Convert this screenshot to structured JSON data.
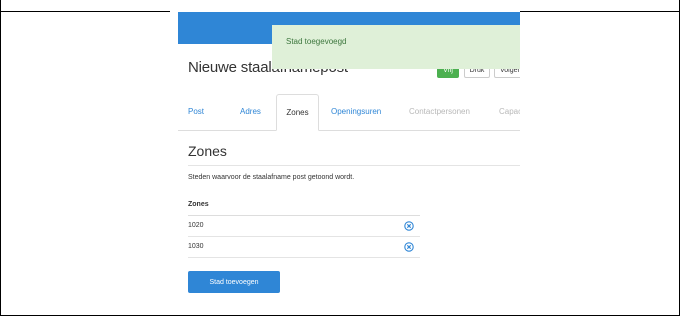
{
  "toast": {
    "message": "Stad toegevoegd"
  },
  "header": {
    "title": "Nieuwe staalafnamepost",
    "buttons": {
      "save": "Vrij",
      "print": "Druk",
      "next": "Volgende"
    }
  },
  "tabs": [
    {
      "label": "Post",
      "state": "link"
    },
    {
      "label": "Adres",
      "state": "link"
    },
    {
      "label": "Zones",
      "state": "active"
    },
    {
      "label": "Openingsuren",
      "state": "link"
    },
    {
      "label": "Contactpersonen",
      "state": "disabled"
    },
    {
      "label": "Capaciteit",
      "state": "disabled"
    }
  ],
  "zones": {
    "section_title": "Zones",
    "description": "Steden waarvoor de staalafname post getoond wordt.",
    "column_header": "Zones",
    "rows": [
      {
        "value": "1020"
      },
      {
        "value": "1030"
      }
    ],
    "remove_icon": "remove-circle-icon",
    "add_button": "Stad toevoegen"
  },
  "colors": {
    "navbar": "#2f86d6",
    "toast_bg": "#dff0d8",
    "toast_text": "#3c763d",
    "primary": "#2f86d6",
    "save": "#4cb050"
  }
}
